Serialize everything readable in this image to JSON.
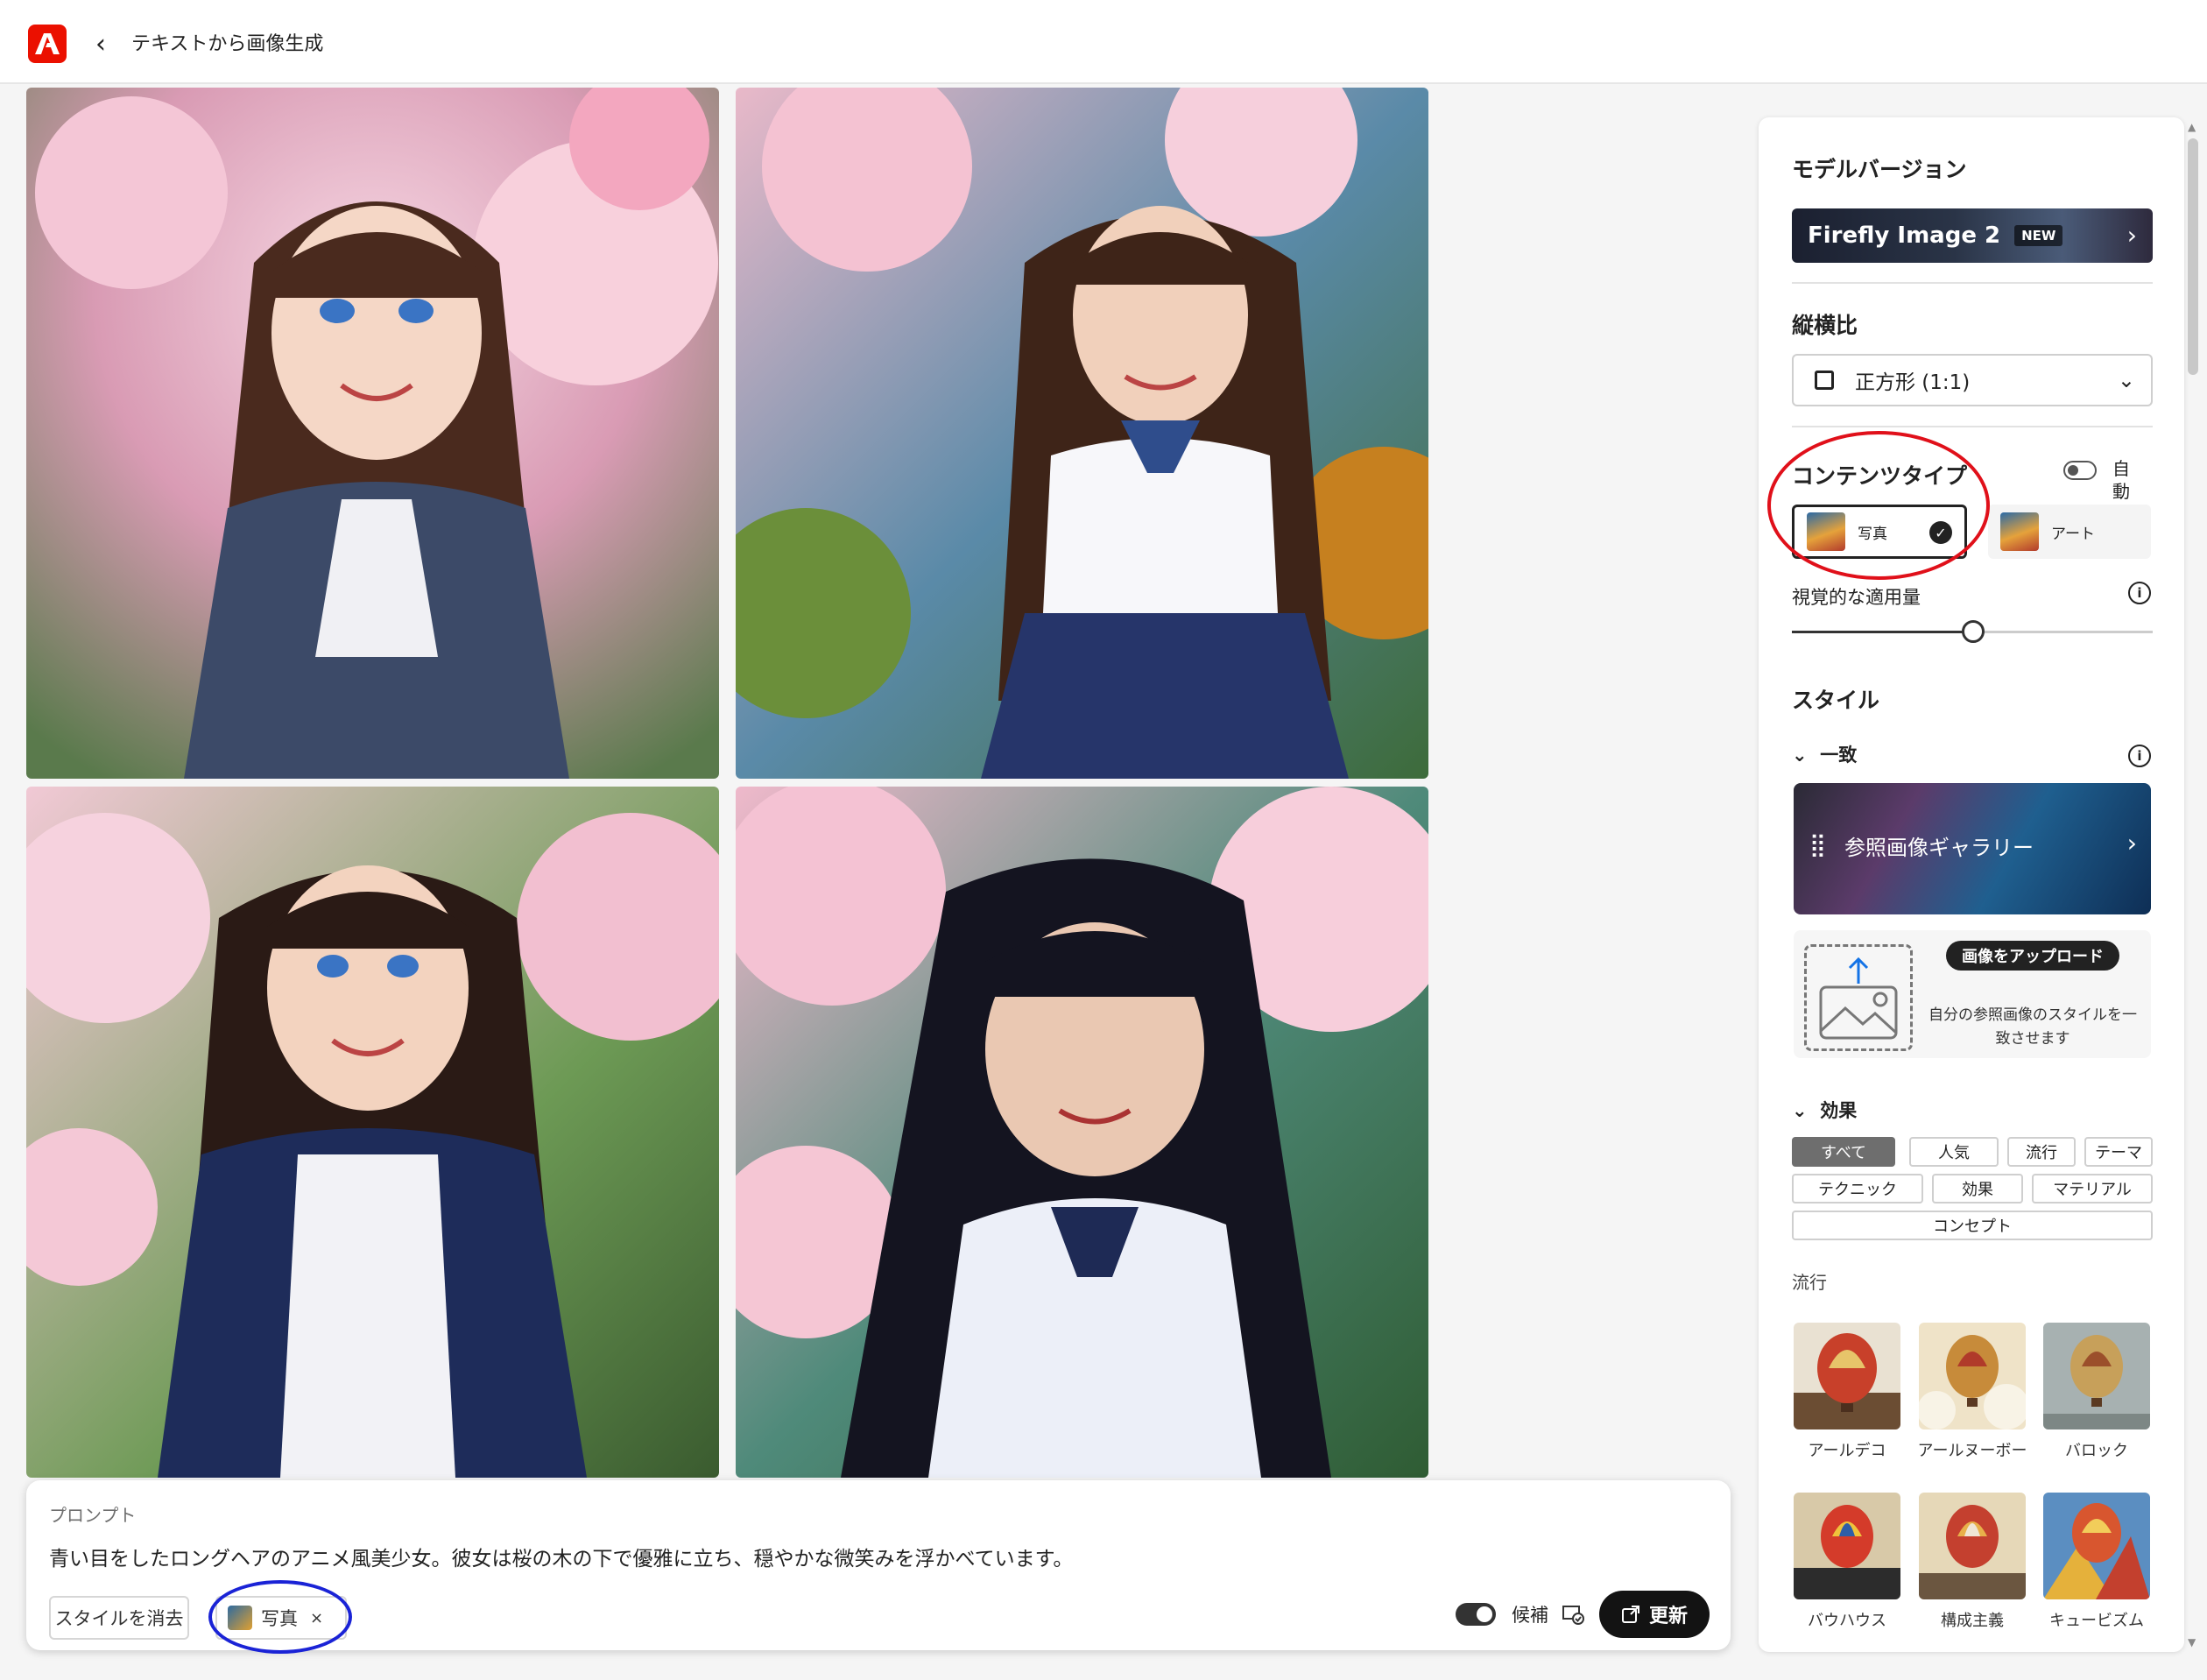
{
  "header": {
    "crumb": "テキストから画像生成"
  },
  "prompt": {
    "label": "プロンプト",
    "text": "青い目をしたロングヘアのアニメ風美少女。彼女は桜の木の下で優雅に立ち、穏やかな微笑みを浮かべています。",
    "clear_style": "スタイルを消去",
    "chip_label": "写真",
    "chip_close": "×",
    "candidates_label": "候補",
    "update_label": "更新"
  },
  "panel": {
    "model_title": "モデルバージョン",
    "model_name": "Firefly Image 2",
    "model_badge": "NEW",
    "ratio_title": "縦横比",
    "ratio_value": "正方形 (1:1)",
    "content_title": "コンテンツタイプ",
    "auto_label": "自動",
    "content_photo": "写真",
    "content_art": "アート",
    "intensity_label": "視覚的な適用量",
    "intensity_value": 0.5,
    "style_title": "スタイル",
    "match_title": "一致",
    "gallery_label": "参照画像ギャラリー",
    "upload_button": "画像をアップロード",
    "upload_desc": "自分の参照画像のスタイルを一致させます",
    "effects_title": "効果",
    "filters": [
      "すべて",
      "人気",
      "流行",
      "テーマ",
      "テクニック",
      "効果",
      "マテリアル",
      "コンセプト"
    ],
    "trend_label": "流行",
    "styles": [
      "アールデコ",
      "アールヌーボー",
      "バロック",
      "バウハウス",
      "構成主義",
      "キュービズム"
    ]
  },
  "colors": {
    "brand": "#eb1000",
    "red_highlight": "#e0101a",
    "blue_highlight": "#1a23d6"
  }
}
